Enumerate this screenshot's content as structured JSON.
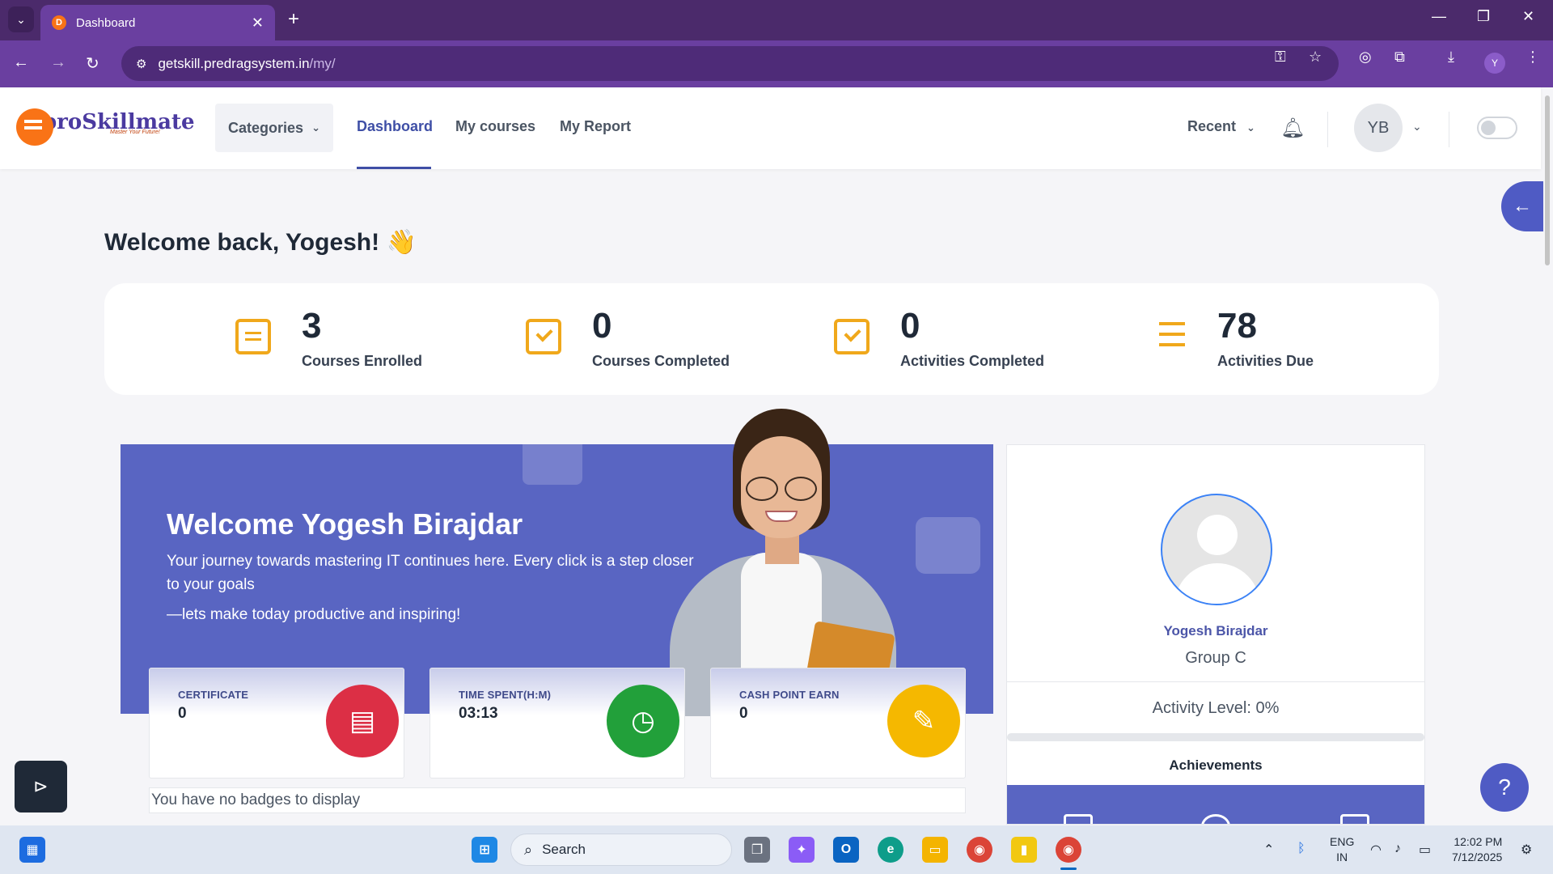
{
  "browser": {
    "tab_title": "Dashboard",
    "url_host": "getskill.predragsystem.in",
    "url_path": "/my/",
    "profile_initial": "Y"
  },
  "header": {
    "logo_text": "proSkillmate",
    "logo_tagline": "Master Your Future!",
    "categories_label": "Categories",
    "nav": [
      "Dashboard",
      "My courses",
      "My Report"
    ],
    "active_nav": "Dashboard",
    "recent_label": "Recent",
    "avatar_initials": "YB"
  },
  "main": {
    "welcome_title": "Welcome back, Yogesh! 👋",
    "stats": [
      {
        "value": "3",
        "label": "Courses Enrolled",
        "icon": "clipboard-list-icon"
      },
      {
        "value": "0",
        "label": "Courses Completed",
        "icon": "copy-check-icon"
      },
      {
        "value": "0",
        "label": "Activities Completed",
        "icon": "checkbox-icon"
      },
      {
        "value": "78",
        "label": "Activities Due",
        "icon": "task-list-icon"
      }
    ],
    "banner": {
      "title": "Welcome Yogesh Birajdar",
      "text": "Your journey towards mastering IT continues here. Every click is a step closer to your goals",
      "text2": "—lets make today productive and inspiring!"
    },
    "metrics": [
      {
        "label": "CERTIFICATE",
        "value": "0",
        "icon": "certificate-icon",
        "color": "#dc2f45"
      },
      {
        "label": "TIME SPENT(H:M)",
        "value": "03:13",
        "icon": "clock-icon",
        "color": "#22a03a"
      },
      {
        "label": "CASH POINT EARN",
        "value": "0",
        "icon": "edit-doc-icon",
        "color": "#f5b800"
      }
    ],
    "no_badges": "You have no badges to display"
  },
  "profile": {
    "name": "Yogesh Birajdar",
    "group": "Group C",
    "activity_level": "Activity Level: 0%",
    "activity_fraction": 0,
    "achievements_title": "Achievements"
  },
  "taskbar": {
    "search_placeholder": "Search",
    "lang_line1": "ENG",
    "lang_line2": "IN",
    "time": "12:02 PM",
    "date": "7/12/2025"
  },
  "colors": {
    "accent": "#4f5bc4",
    "banner": "#5965c2",
    "stat_icon": "#f0a81b",
    "browser_chrome": "#6a3fa0"
  }
}
